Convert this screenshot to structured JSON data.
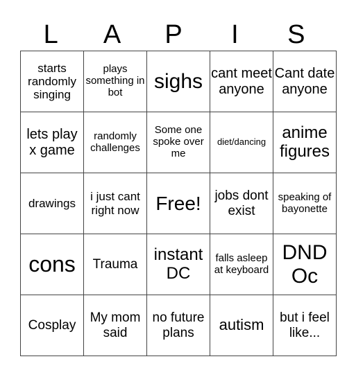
{
  "title_letters": [
    "L",
    "A",
    "P",
    "I",
    "S"
  ],
  "board": [
    [
      "starts randomly singing",
      "plays something in bot",
      "sighs",
      "cant meet anyone",
      "Cant date anyone"
    ],
    [
      "lets play x game",
      "randomly challenges",
      "Some one spoke over me",
      "diet/dancing",
      "anime figures"
    ],
    [
      "drawings",
      "i just cant right now",
      "Free!",
      "jobs dont exist",
      "speaking of bayonette"
    ],
    [
      "cons",
      "Trauma",
      "instant DC",
      "falls asleep at keyboard",
      "DND Oc"
    ],
    [
      "Cosplay",
      "My mom said",
      "no future plans",
      "autism",
      "but i feel like..."
    ]
  ],
  "free_cell": "Free!"
}
